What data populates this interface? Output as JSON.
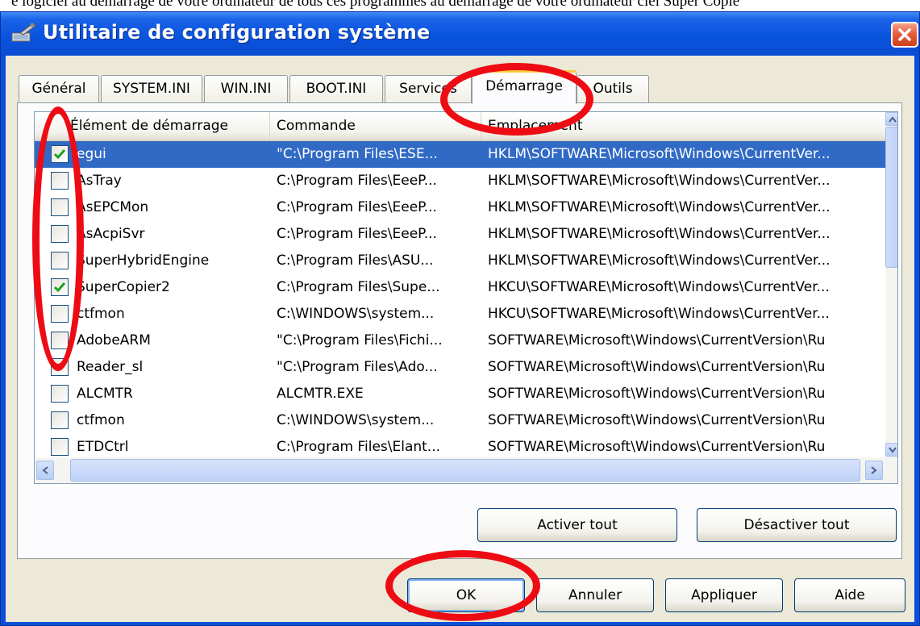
{
  "page_caption": "e logiciel au démarrage de votre ordinateur de tous ces programmes au démarrage de votre ordinateur ciel Super Copie",
  "window": {
    "title": "Utilitaire de configuration système",
    "icon": "msconfig-icon",
    "close_icon": "close-x-icon"
  },
  "tabs": [
    {
      "label": "Général"
    },
    {
      "label": "SYSTEM.INI"
    },
    {
      "label": "WIN.INI"
    },
    {
      "label": "BOOT.INI"
    },
    {
      "label": "Services"
    },
    {
      "label": "Démarrage",
      "active": true
    },
    {
      "label": "Outils"
    }
  ],
  "startup_list": {
    "columns": [
      "Élément de démarrage",
      "Commande",
      "Emplacement"
    ],
    "rows": [
      {
        "checked": true,
        "selected": true,
        "item": "egui",
        "command": "\"C:\\Program Files\\ESE...",
        "location": "HKLM\\SOFTWARE\\Microsoft\\Windows\\CurrentVer..."
      },
      {
        "checked": false,
        "item": "AsTray",
        "command": "C:\\Program Files\\EeeP...",
        "location": "HKLM\\SOFTWARE\\Microsoft\\Windows\\CurrentVer..."
      },
      {
        "checked": false,
        "item": "AsEPCMon",
        "command": "C:\\Program Files\\EeeP...",
        "location": "HKLM\\SOFTWARE\\Microsoft\\Windows\\CurrentVer..."
      },
      {
        "checked": false,
        "item": "AsAcpiSvr",
        "command": "C:\\Program Files\\EeeP...",
        "location": "HKLM\\SOFTWARE\\Microsoft\\Windows\\CurrentVer..."
      },
      {
        "checked": false,
        "item": "SuperHybridEngine",
        "command": "C:\\Program Files\\ASU...",
        "location": "HKLM\\SOFTWARE\\Microsoft\\Windows\\CurrentVer..."
      },
      {
        "checked": true,
        "item": "SuperCopier2",
        "command": "C:\\Program Files\\Supe...",
        "location": "HKCU\\SOFTWARE\\Microsoft\\Windows\\CurrentVer..."
      },
      {
        "checked": false,
        "item": "ctfmon",
        "command": "C:\\WINDOWS\\system...",
        "location": "HKCU\\SOFTWARE\\Microsoft\\Windows\\CurrentVer..."
      },
      {
        "checked": false,
        "item": "AdobeARM",
        "command": "\"C:\\Program Files\\Fichi...",
        "location": "SOFTWARE\\Microsoft\\Windows\\CurrentVersion\\Ru"
      },
      {
        "checked": false,
        "item": "Reader_sl",
        "command": "\"C:\\Program Files\\Ado...",
        "location": "SOFTWARE\\Microsoft\\Windows\\CurrentVersion\\Ru"
      },
      {
        "checked": false,
        "item": "ALCMTR",
        "command": "ALCMTR.EXE",
        "location": "SOFTWARE\\Microsoft\\Windows\\CurrentVersion\\Ru"
      },
      {
        "checked": false,
        "item": "ctfmon",
        "command": "C:\\WINDOWS\\system...",
        "location": "SOFTWARE\\Microsoft\\Windows\\CurrentVersion\\Ru"
      },
      {
        "checked": false,
        "item": "ETDCtrl",
        "command": "C:\\Program Files\\Elant...",
        "location": "SOFTWARE\\Microsoft\\Windows\\CurrentVersion\\Ru"
      }
    ]
  },
  "buttons": {
    "enable_all": "Activer tout",
    "disable_all": "Désactiver tout",
    "ok": "OK",
    "cancel": "Annuler",
    "apply": "Appliquer",
    "help": "Aide"
  },
  "colors": {
    "titlebar": "#0a54de",
    "selection": "#316ac5",
    "annotation": "#ee0c14",
    "dialog_face": "#ece9d8"
  }
}
